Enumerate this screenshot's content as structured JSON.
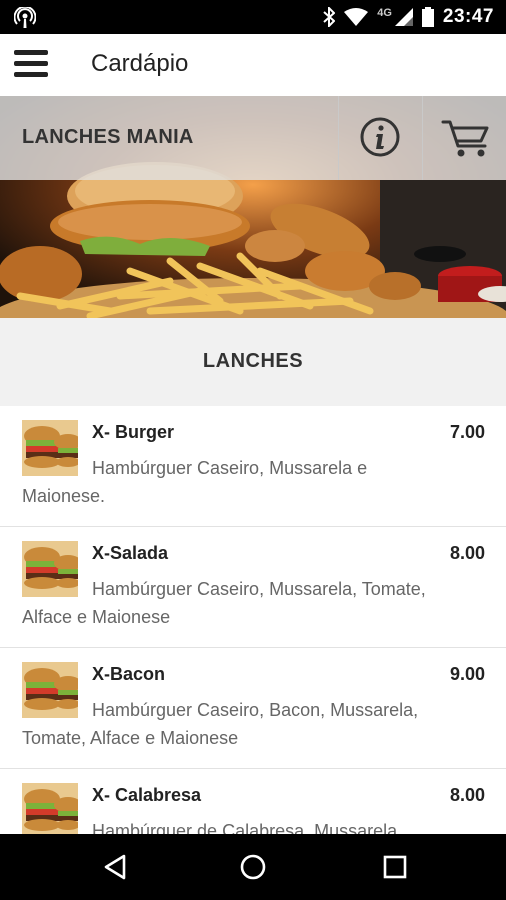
{
  "status_bar": {
    "time": "23:47",
    "network": "4G"
  },
  "app_bar": {
    "title": "Cardápio"
  },
  "store": {
    "name": "LANCHES MANIA"
  },
  "section": {
    "title": "LANCHES"
  },
  "menu_items": [
    {
      "name": "X- Burger",
      "price": "7.00",
      "description": "Hambúrguer Caseiro, Mussarela e Maionese."
    },
    {
      "name": "X-Salada",
      "price": "8.00",
      "description": "Hambúrguer Caseiro, Mussarela, Tomate, Alface e Maionese"
    },
    {
      "name": "X-Bacon",
      "price": "9.00",
      "description": "Hambúrguer Caseiro, Bacon, Mussarela, Tomate, Alface e Maionese"
    },
    {
      "name": "X- Calabresa",
      "price": "8.00",
      "description": "Hambúrguer de Calabresa, Mussarela"
    }
  ],
  "icons": [
    "podcast-icon",
    "bluetooth-icon",
    "wifi-icon",
    "signal-icon",
    "battery-icon",
    "menu-icon",
    "info-icon",
    "cart-icon",
    "back-icon",
    "home-icon",
    "recents-icon"
  ]
}
